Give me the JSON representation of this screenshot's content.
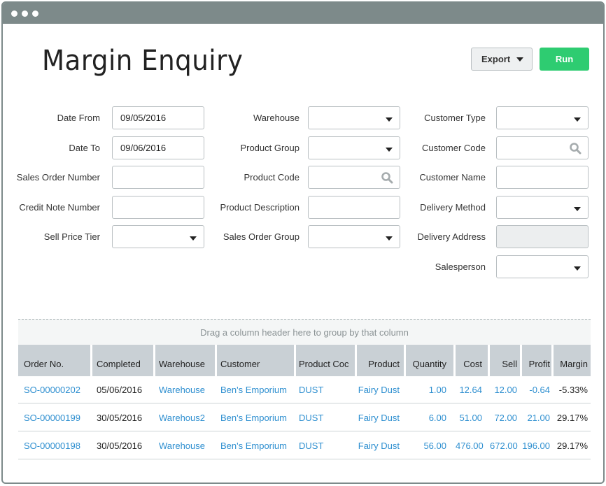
{
  "window": {
    "controls": [
      "dot",
      "dot",
      "dot"
    ]
  },
  "header": {
    "title": "Margin Enquiry",
    "export_label": "Export",
    "run_label": "Run",
    "run_color": "#2ecc71"
  },
  "filters": {
    "col1": [
      {
        "label": "Date From",
        "value": "09/05/2016",
        "type": "text"
      },
      {
        "label": "Date To",
        "value": "09/06/2016",
        "type": "text"
      },
      {
        "label": "Sales Order Number",
        "value": "",
        "type": "text"
      },
      {
        "label": "Credit Note Number",
        "value": "",
        "type": "text"
      },
      {
        "label": "Sell Price Tier",
        "value": "",
        "type": "select"
      }
    ],
    "col2": [
      {
        "label": "Warehouse",
        "value": "",
        "type": "select"
      },
      {
        "label": "Product Group",
        "value": "",
        "type": "select"
      },
      {
        "label": "Product Code",
        "value": "",
        "type": "search"
      },
      {
        "label": "Product Description",
        "value": "",
        "type": "text"
      },
      {
        "label": "Sales Order Group",
        "value": "",
        "type": "select"
      }
    ],
    "col3": [
      {
        "label": "Customer Type",
        "value": "",
        "type": "select"
      },
      {
        "label": "Customer Code",
        "value": "",
        "type": "search"
      },
      {
        "label": "Customer Name",
        "value": "",
        "type": "text"
      },
      {
        "label": "Delivery Method",
        "value": "",
        "type": "select"
      },
      {
        "label": "Delivery Address",
        "value": "",
        "type": "disabled"
      },
      {
        "label": "Salesperson",
        "value": "",
        "type": "select"
      }
    ]
  },
  "grid": {
    "group_hint": "Drag a column header here to group by that column",
    "columns": [
      "Order No.",
      "Completed",
      "Warehouse",
      "Customer",
      "Product Coc",
      "Product",
      "Quantity",
      "Cost",
      "Sell",
      "Profit",
      "Margin"
    ],
    "rows": [
      [
        "SO-00000202",
        "05/06/2016",
        "Warehouse",
        "Ben's Emporium",
        "DUST",
        "Fairy Dust",
        "1.00",
        "12.64",
        "12.00",
        "-0.64",
        "-5.33%"
      ],
      [
        "SO-00000199",
        "30/05/2016",
        "Warehous2",
        "Ben's Emporium",
        "DUST",
        "Fairy Dust",
        "6.00",
        "51.00",
        "72.00",
        "21.00",
        "29.17%"
      ],
      [
        "SO-00000198",
        "30/05/2016",
        "Warehouse",
        "Ben's Emporium",
        "DUST",
        "Fairy Dust",
        "56.00",
        "476.00",
        "672.00",
        "196.00",
        "29.17%"
      ]
    ],
    "link_color": "#2e8fd0"
  }
}
